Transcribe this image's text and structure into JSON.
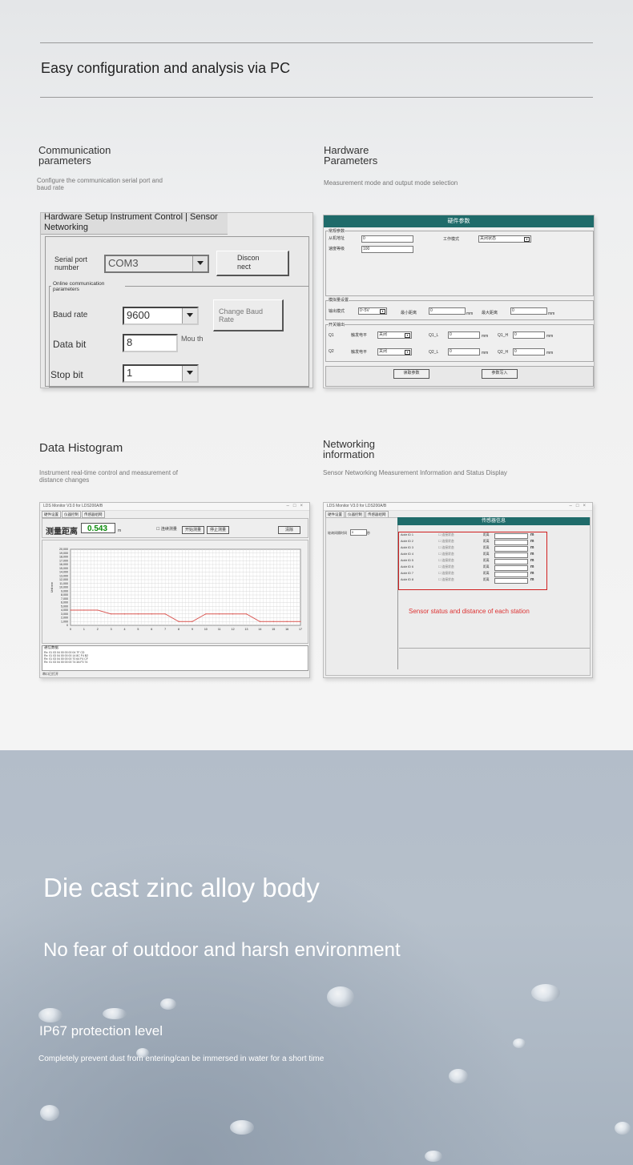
{
  "header": {
    "title": "Easy configuration and analysis via PC"
  },
  "sections": {
    "comm": {
      "title": "Communication parameters",
      "desc": "Configure the communication serial port and baud rate"
    },
    "hw": {
      "title": "Hardware Parameters",
      "desc": "Measurement mode and output mode selection"
    },
    "hist": {
      "title": "Data Histogram",
      "desc": "Instrument real-time control and measurement of distance changes"
    },
    "net": {
      "title": "Networking information",
      "desc": "Sensor Networking Measurement Information and Status Display"
    }
  },
  "comm_window": {
    "tab_header": "Hardware Setup Instrument Control | Sensor Networking",
    "serial_port_label": "Serial port number",
    "serial_port_value": "COM3",
    "disconnect_label": "Discon nect",
    "online_group_label": "Online communication parameters",
    "baud_rate_label": "Baud rate",
    "baud_rate_value": "9600",
    "change_baud_label": "Change Baud Rate",
    "data_bit_label": "Data bit",
    "data_bit_value": "8",
    "mouth_label": "Mou th",
    "stop_bit_label": "Stop bit",
    "stop_bit_value": "1"
  },
  "hw_window": {
    "title": "硬件参数",
    "common_group": "常规参数",
    "slave_addr_label": "从机地址",
    "slave_addr_value": "0",
    "speed_label": "速度等级",
    "speed_value": "100",
    "work_mode_label": "工作模式",
    "work_mode_value": "关闭状态",
    "analog_group": "模拟量设置",
    "output_mode_label": "输出模式",
    "output_mode_value": "0~5V",
    "min_dist_label": "最小距离",
    "min_dist_value": "0",
    "max_dist_label": "最大距离",
    "max_dist_value": "0",
    "unit_mm": "mm",
    "switch_group": "开关输出",
    "q1_label": "Q1",
    "q2_label": "Q2",
    "trigger_label": "触发电平",
    "trigger_value": "关闭",
    "q1l_label": "Q1_L",
    "q1h_label": "Q1_H",
    "q2l_label": "Q2_L",
    "q2h_label": "Q2_H",
    "zero": "0",
    "read_button": "读取参数",
    "write_button": "参数写入"
  },
  "hist_window": {
    "titlebar": "LDS Monitor V3.0 for LDS200A/B",
    "tabs": [
      "硬件设置",
      "仪器控制",
      "传感器组网"
    ],
    "measure_label": "测量距离",
    "measure_value": "0.543",
    "unit": "m",
    "checkbox_label": "连续测量",
    "start_button": "开始测量",
    "stop_button": "停止测量",
    "clear_button": "清除",
    "log_title": "通信数据",
    "log_lines": [
      "Rx: 01 03 04 00 00 00 04 7F CD",
      "Rx: 01 03 04 00 00 00 14 8C F4 B2",
      "Rx: 01 03 04 00 00 00 70 64 F4 CF",
      "Rx: 01 03 04 00 00 00 74 3A F3 74"
    ],
    "status_text": "串口已打开"
  },
  "net_window": {
    "titlebar": "LDS Monitor V3.0 for LDS200A/B",
    "tabs": [
      "硬件设置",
      "仪器控制",
      "传感器组网"
    ],
    "sensor_title": "传感器信息",
    "interval_label": "轮询间隔时间",
    "interval_value": "0",
    "interval_unit": "秒",
    "addr_rows": [
      "Addr ID 1",
      "Addr ID 2",
      "Addr ID 3",
      "Addr ID 4",
      "Addr ID 5",
      "Addr ID 6",
      "Addr ID 7",
      "Addr ID 8"
    ],
    "status_label": "连接状态",
    "distance_label": "距离",
    "unit": "m",
    "annotation": "Sensor status and distance of each station"
  },
  "chart_data": {
    "type": "line",
    "x": [
      0,
      1,
      2,
      3,
      4,
      5,
      6,
      7,
      8,
      9,
      10,
      11,
      12,
      13,
      14,
      15,
      16,
      17
    ],
    "series": [
      {
        "values": [
          4000,
          4000,
          4000,
          3000,
          3000,
          3000,
          3000,
          3000,
          1000,
          1000,
          3000,
          3000,
          3000,
          3000,
          1000,
          1000,
          1000,
          1000
        ]
      }
    ],
    "ylim": [
      0,
      20000
    ],
    "xlim": [
      0,
      17
    ],
    "yticks": [
      "0",
      "1,000",
      "2,000",
      "3,000",
      "4,000",
      "5,000",
      "6,000",
      "7,000",
      "8,000",
      "9,000",
      "10,000",
      "11,000",
      "12,000",
      "13,000",
      "14,000",
      "15,000",
      "16,000",
      "17,000",
      "18,000",
      "19,000",
      "20,000"
    ],
    "xticks": [
      "0",
      "1",
      "2",
      "3",
      "4",
      "5",
      "6",
      "7",
      "8",
      "9",
      "10",
      "11",
      "12",
      "13",
      "14",
      "15",
      "16",
      "17"
    ],
    "ylabel": "Unit:mm",
    "grid": true,
    "line_color": "#d9534f"
  },
  "feature": {
    "headline": "Die cast zinc alloy body",
    "subheadline": "No fear of outdoor and harsh environment",
    "ip_title": "IP67 protection level",
    "ip_desc": "Completely prevent dust from entering/can be immersed in water for a short time"
  }
}
